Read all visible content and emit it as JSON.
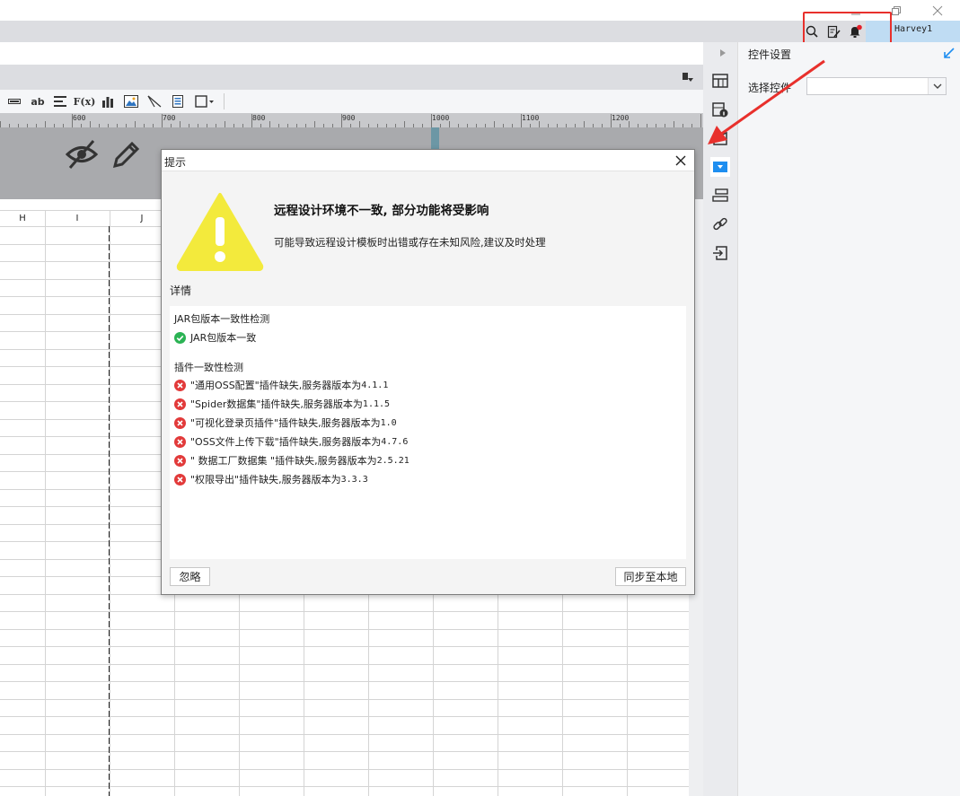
{
  "titlebar": {
    "minimize_icon": "minimize-icon",
    "restore_icon": "restore-icon",
    "close_icon": "close-icon"
  },
  "topbar": {
    "username": "Harvey1",
    "icons": [
      "search-icon",
      "edit-document-icon",
      "bell-icon"
    ],
    "highlight_color": "#e8302c"
  },
  "toolbar": {
    "text_label": "ab",
    "formula_label": "F(x)"
  },
  "ruler": {
    "labels": [
      "600",
      "700",
      "800",
      "900",
      "1000",
      "1100",
      "1200"
    ]
  },
  "grid": {
    "column_headers": [
      "H",
      "I",
      "J"
    ]
  },
  "side_panel": {
    "title": "控件设置",
    "select_label": "选择控件",
    "select_value": ""
  },
  "dialog": {
    "title": "提示",
    "heading": "远程设计环境不一致, 部分功能将受影响",
    "subtext": "可能导致远程设计模板时出错或存在未知风险,建议及时处理",
    "detail_label": "详情",
    "jar_section": {
      "title": "JAR包版本一致性检测",
      "result": "JAR包版本一致"
    },
    "plugin_section": {
      "title": "插件一致性检测",
      "items": [
        {
          "text": "\"通用OSS配置\"插件缺失,服务器版本为",
          "version": "4.1.1"
        },
        {
          "text": "\"Spider数据集\"插件缺失,服务器版本为",
          "version": "1.1.5"
        },
        {
          "text": "\"可视化登录页插件\"插件缺失,服务器版本为",
          "version": "1.0"
        },
        {
          "text": "\"OSS文件上传下载\"插件缺失,服务器版本为",
          "version": "4.7.6"
        },
        {
          "text": "\" 数据工厂数据集 \"插件缺失,服务器版本为",
          "version": "2.5.21"
        },
        {
          "text": "\"权限导出\"插件缺失,服务器版本为",
          "version": "3.3.3"
        }
      ]
    },
    "ignore_button": "忽略",
    "sync_button": "同步至本地",
    "warning_color": "#f3ea3c",
    "success_color": "#2bb354",
    "error_color": "#e23a3a"
  },
  "annotation": {
    "arrow_color": "#e8302c"
  }
}
